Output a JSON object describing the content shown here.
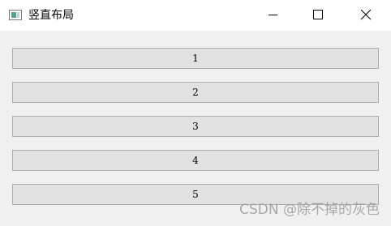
{
  "window": {
    "title": "竖直布局",
    "icon": "window-app-icon",
    "controls": {
      "minimize_icon": "minimize-icon",
      "maximize_icon": "maximize-icon",
      "close_icon": "close-icon"
    }
  },
  "buttons": [
    {
      "label": "1"
    },
    {
      "label": "2"
    },
    {
      "label": "3"
    },
    {
      "label": "4"
    },
    {
      "label": "5"
    }
  ],
  "watermark": {
    "text": "CSDN @除不掉的灰色"
  },
  "colors": {
    "background": "#f0f0f0",
    "titlebar": "#ffffff",
    "button_face": "#e1e1e1",
    "button_border": "#adadad"
  }
}
